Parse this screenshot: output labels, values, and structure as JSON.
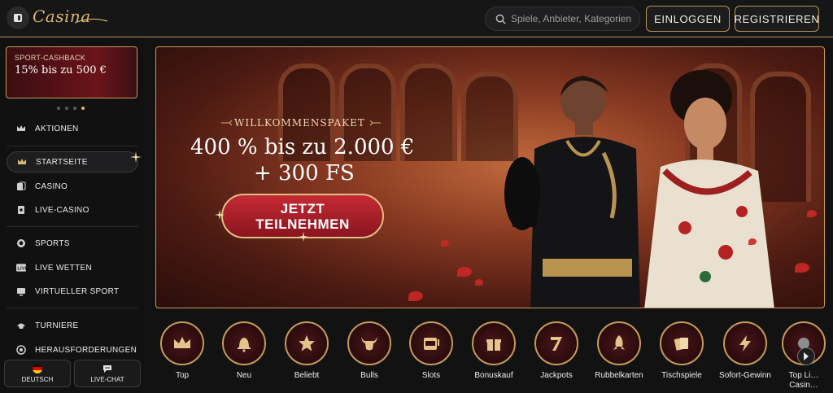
{
  "header": {
    "logo_text": "Casina",
    "search_placeholder": "Spiele, Anbieter, Kategorien",
    "login_label": "EINLOGGEN",
    "register_label": "REGISTRIEREN"
  },
  "sidebar": {
    "promo": {
      "title": "SPORT-CASHBACK",
      "offer": "15% bis zu 500 €"
    },
    "carousel_dots": 4,
    "active_dot": 4,
    "items": [
      {
        "label": "AKTIONEN",
        "icon": "crown-icon"
      },
      {
        "label": "STARTSEITE",
        "icon": "home-crown-icon",
        "active": true
      },
      {
        "label": "CASINO",
        "icon": "cards-icon"
      },
      {
        "label": "LIVE-CASINO",
        "icon": "live-cards-icon"
      },
      {
        "label": "SPORTS",
        "icon": "ball-icon"
      },
      {
        "label": "LIVE WETTEN",
        "icon": "live-badge-icon"
      },
      {
        "label": "VIRTUELLER SPORT",
        "icon": "screen-icon"
      },
      {
        "label": "TURNIERE",
        "icon": "rocket-icon"
      },
      {
        "label": "HERAUSFORDERUNGEN",
        "icon": "target-icon"
      }
    ],
    "bottom": {
      "language": "DEUTSCH",
      "chat": "LIVE-CHAT"
    }
  },
  "banner": {
    "kicker": "WILLKOMMENSPAKET",
    "headline_1": "400 % bis zu 2.000 €",
    "headline_2": "+ 300 FS",
    "cta_line1": "JETZT",
    "cta_line2": "TEILNEHMEN"
  },
  "categories": [
    {
      "label": "Top",
      "icon": "crown-icon"
    },
    {
      "label": "Neu",
      "icon": "bell-icon"
    },
    {
      "label": "Beliebt",
      "icon": "star-icon"
    },
    {
      "label": "Bulls",
      "icon": "bull-icon"
    },
    {
      "label": "Slots",
      "icon": "slot-machine-icon"
    },
    {
      "label": "Bonuskauf",
      "icon": "gift-icon"
    },
    {
      "label": "Jackpots",
      "icon": "seven-icon"
    },
    {
      "label": "Rubbelkarten",
      "icon": "rocket-icon"
    },
    {
      "label": "Tischspiele",
      "icon": "playing-cards-icon"
    },
    {
      "label": "Sofort-Gewinn",
      "icon": "lightning-icon"
    },
    {
      "label": "Top Li… Casin…",
      "icon": "live-icon"
    }
  ],
  "colors": {
    "accent_gold": "#c59b55",
    "cta_red": "#c52a33",
    "background": "#121213"
  }
}
